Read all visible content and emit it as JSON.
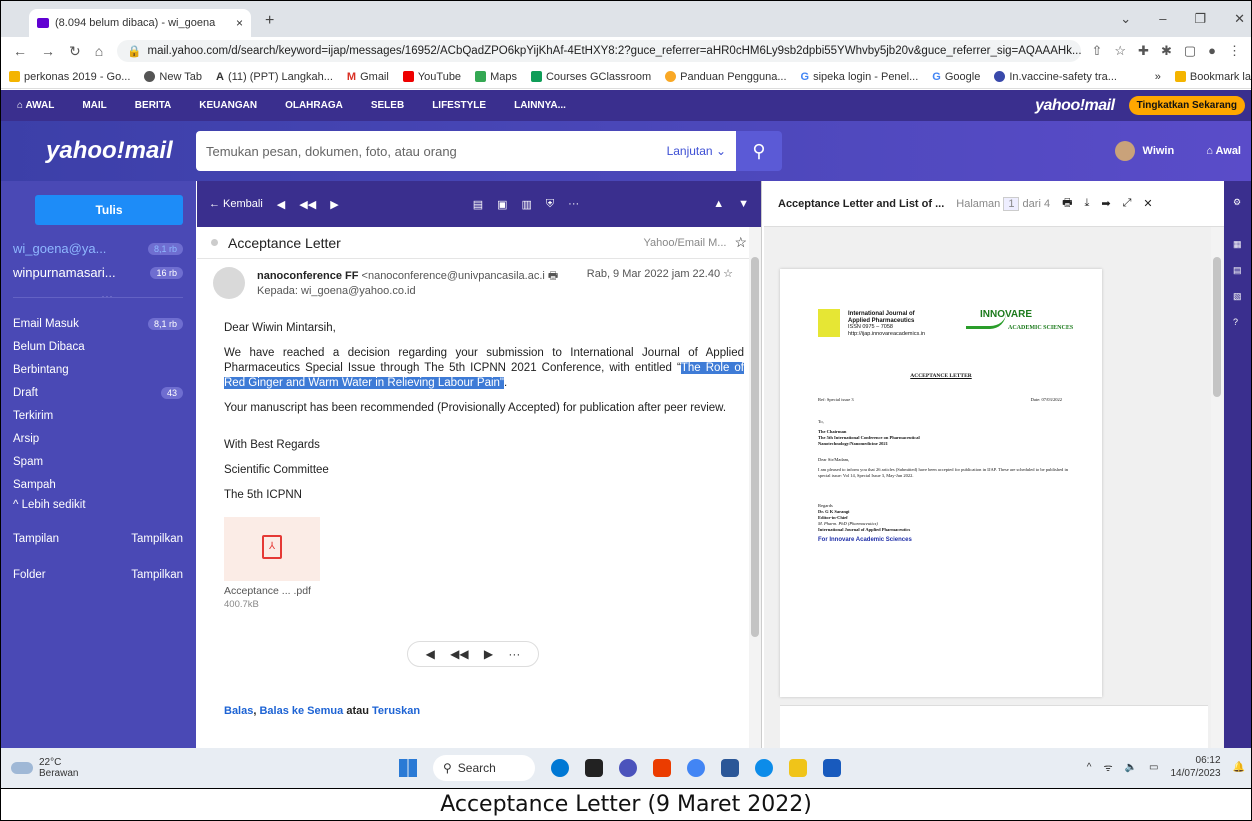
{
  "browser": {
    "tab_title": "(8.094 belum dibaca) - wi_goena",
    "tab_close": "×",
    "new_tab": "+",
    "url": "mail.yahoo.com/d/search/keyword=ijap/messages/16952/ACbQadZPO6kpYijKhAf-4EtHXY8:2?guce_referrer=aHR0cHM6Ly9sb2dpbi55YWhvby5jb20v&guce_referrer_sig=AQAAAHk...",
    "bookmarks": [
      "perkonas 2019 - Go...",
      "New Tab",
      "(11) (PPT) Langkah...",
      "Gmail",
      "YouTube",
      "Maps",
      "Courses GClassroom",
      "Panduan Pengguna...",
      "sipeka login - Penel...",
      "Google",
      "In.vaccine-safety tra..."
    ],
    "bookmarks_more": "»",
    "bookmarks_folder": "Bookmark la",
    "colors": {
      "tabbar": "#dfe3e8"
    }
  },
  "yahoo_nav": {
    "items": [
      "AWAL",
      "MAIL",
      "BERITA",
      "KEUANGAN",
      "OLAHRAGA",
      "SELEB",
      "LIFESTYLE",
      "LAINNYA..."
    ],
    "logo": "yahoo!mail",
    "upgrade": "Tingkatkan Sekarang"
  },
  "header": {
    "logo": "yahoo!mail",
    "search_placeholder": "Temukan pesan, dokumen, foto, atau orang",
    "advanced": "Lanjutan",
    "user": "Wiwin",
    "home": "Awal"
  },
  "sidebar": {
    "compose": "Tulis",
    "accounts": [
      {
        "name": "wi_goena@ya...",
        "count": "8,1 rb"
      },
      {
        "name": "winpurnamasari...",
        "count": "16 rb"
      }
    ],
    "folders": [
      {
        "label": "Email Masuk",
        "count": "8,1 rb"
      },
      {
        "label": "Belum Dibaca",
        "count": ""
      },
      {
        "label": "Berbintang",
        "count": ""
      },
      {
        "label": "Draft",
        "count": "43"
      },
      {
        "label": "Terkirim",
        "count": ""
      },
      {
        "label": "Arsip",
        "count": ""
      },
      {
        "label": "Spam",
        "count": ""
      },
      {
        "label": "Sampah",
        "count": ""
      },
      {
        "label": "^ Lebih sedikit",
        "count": ""
      }
    ],
    "views": [
      {
        "label": "Tampilan",
        "action": "Tampilkan"
      },
      {
        "label": "Folder",
        "action": "Tampilkan"
      }
    ]
  },
  "message": {
    "back": "← Kembali",
    "subject": "Acceptance Letter",
    "source": "Yahoo/Email M...",
    "sender_name": "nanoconference FF",
    "sender_email": "<nanoconference@univpancasila.ac.i",
    "recipient": "Kepada: wi_goena@yahoo.co.id",
    "date": "Rab, 9 Mar 2022 jam 22.40",
    "greeting": "Dear Wiwin Mintarsih,",
    "para1_a": "We have reached a decision regarding your submission to International Journal of Applied Pharmaceutics Special Issue through The 5th ICPNN 2021 Conference, with entitled “",
    "para1_hl": "The Role of Red Ginger and Warm Water in Relieving Labour Pain\"",
    "para1_b": ".",
    "para2": "Your manuscript has been recommended (Provisionally Accepted) for publication after peer review.",
    "sign1": "With Best Regards",
    "sign2": "Scientific Committee",
    "sign3": "The 5th ICPNN",
    "attachment_name": "Acceptance ... .pdf",
    "attachment_size": "400.7kB",
    "reply": "Balas",
    "reply_all": "Balas ke Semua",
    "or": "atau",
    "forward": "Teruskan"
  },
  "viewer": {
    "title": "Acceptance Letter and List of ...",
    "page_label": "Halaman",
    "page_num": "1",
    "page_of": "dari 4",
    "doc": {
      "journal_line1": "International Journal of",
      "journal_line2": "Applied Pharmaceutics",
      "issn": "ISSN 0975 – 7058",
      "url": "http://ijap.innovareacademics.in",
      "brand": "INNOVARE",
      "brand_sub": "ACADEMIC SCIENCES",
      "heading": "ACCEPTANCE LETTER",
      "ref": "Ref: Special issue 3",
      "date": "Date: 07/03/2022",
      "to": "To,",
      "chair1": "The Chairman",
      "chair2": "The 5th International Conference on Pharmaceutical",
      "chair3": "Nanotechnology/Nanomedicine 2021",
      "dear": "Dear Sir/Madam,",
      "body": "I am pleased to inform you that 26 articles (Submitted) have been accepted for publication in IJAP. These are scheduled to be published in special issue: Vol 14, Special Issue 3, May-Jun 2022.",
      "regards": "Regards",
      "signer": "Dr. G K Sarangi",
      "role": "Editor-in-Chief",
      "degree": "M. Pharm. PhD (Pharmaceutics)",
      "journal_full": "International Journal of Applied Pharmaceutics",
      "for": "For Innovare Academic Sciences"
    }
  },
  "taskbar": {
    "temp": "22°C",
    "weather": "Berawan",
    "search": "Search",
    "time": "06:12",
    "date": "14/07/2023"
  },
  "caption": "Acceptance Letter (9 Maret 2022)"
}
